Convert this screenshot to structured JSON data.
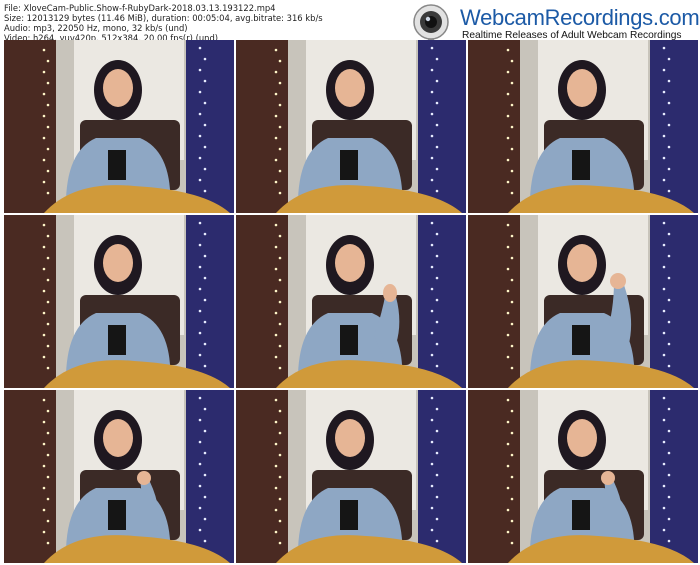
{
  "file_info": {
    "file": "File: XloveCam-Public.Show-f-RubyDark-2018.03.13.193122.mp4",
    "size": "Size: 12013129 bytes (11.46 MiB), duration: 00:05:04, avg.bitrate: 316 kb/s",
    "audio": "Audio: mp3, 22050 Hz, mono, 32 kb/s (und)",
    "video": "Video: h264, yuv420p, 512x384, 20.00 fps(r) (und)"
  },
  "brand": {
    "title": "WebcamRecordings.com",
    "tagline": "Realtime Releases of Adult Webcam Recordings"
  },
  "colors": {
    "brand_blue": "#1c5aa6",
    "wall": "#c8c4bb",
    "curtain_left": "#4a2a22",
    "curtain_right": "#2c2b6e",
    "shirt": "#8ea7c4",
    "skin": "#e6b595",
    "hair": "#1f1820",
    "legs": "#d09a3a"
  },
  "thumbnails": [
    {
      "pose": "hands-down"
    },
    {
      "pose": "hands-down"
    },
    {
      "pose": "hands-down"
    },
    {
      "pose": "hands-down"
    },
    {
      "pose": "hand-on-head"
    },
    {
      "pose": "hand-on-forehead"
    },
    {
      "pose": "hand-on-chin"
    },
    {
      "pose": "hands-down"
    },
    {
      "pose": "hand-on-chin"
    }
  ]
}
